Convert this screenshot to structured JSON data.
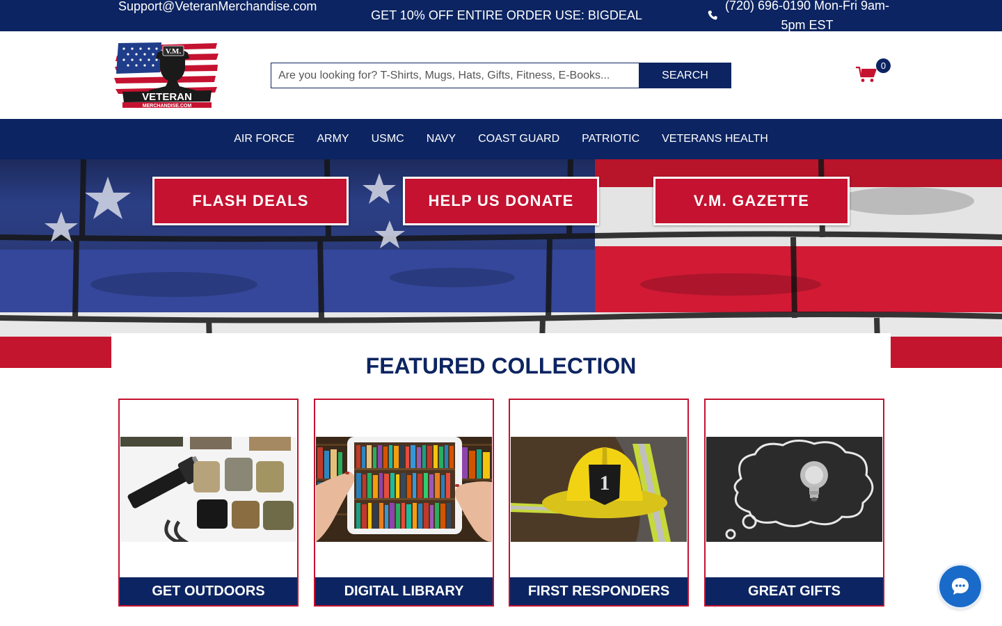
{
  "topbar": {
    "email": "Support@VeteranMerchandise.com",
    "promo": "GET 10% OFF ENTIRE ORDER USE: BIGDEAL",
    "phone_icon": "phone-icon",
    "phone": "(720) 696-0190 Mon-Fri 9am-5pm EST"
  },
  "header": {
    "logo": {
      "icon": "veteran-merchandise-logo",
      "badge_text": "V.M.",
      "brand_text": "VETERAN",
      "sub_text": "MERCHANDISE.COM"
    },
    "search": {
      "placeholder": "Are you looking for? T-Shirts, Mugs, Hats, Gifts, Fitness, E-Books...",
      "button_label": "SEARCH"
    },
    "cart": {
      "icon": "cart-icon",
      "count": "0"
    }
  },
  "nav": {
    "items": [
      "AIR FORCE",
      "ARMY",
      "USMC",
      "NAVY",
      "COAST GUARD",
      "PATRIOTIC",
      "VETERANS HEALTH"
    ]
  },
  "banner": {
    "background": "american-flag-brick-wall",
    "buttons": [
      "FLASH DEALS",
      "HELP US DONATE",
      "V.M. GAZETTE"
    ]
  },
  "featured": {
    "title": "FEATURED COLLECTION",
    "cards": [
      {
        "label": "GET OUTDOORS",
        "image": "outdoor-gear-image"
      },
      {
        "label": "DIGITAL LIBRARY",
        "image": "tablet-bookshelf-image"
      },
      {
        "label": "FIRST RESPONDERS",
        "image": "firefighter-helmet-image"
      },
      {
        "label": "GREAT GIFTS",
        "image": "lightbulb-chalkboard-image"
      }
    ]
  },
  "chat": {
    "icon": "chat-bubble-icon"
  },
  "colors": {
    "navy": "#0c2461",
    "red": "#c41230",
    "white": "#ffffff",
    "chat_blue": "#1a6bc9"
  }
}
